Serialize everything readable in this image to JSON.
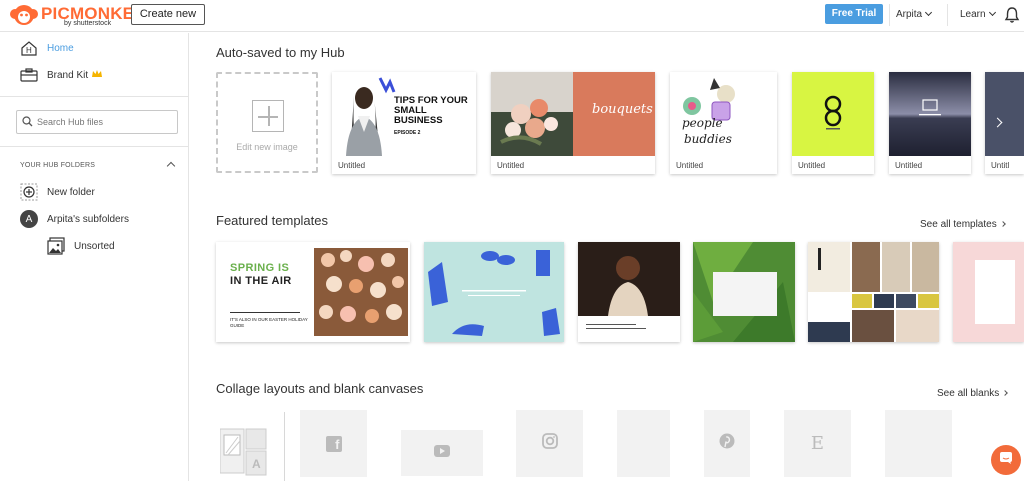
{
  "brand": {
    "name": "PICMONKEY",
    "byline": "by shutterstock",
    "accent": "#ff6b35"
  },
  "header": {
    "create_label": "Create new",
    "trial_label": "Free Trial",
    "user_label": "Arpita",
    "learn_label": "Learn"
  },
  "sidebar": {
    "home_label": "Home",
    "brandkit_label": "Brand Kit",
    "search_placeholder": "Search Hub files",
    "folders_heading": "YOUR HUB FOLDERS",
    "new_folder_label": "New folder",
    "subfolders_label": "Arpita's subfolders",
    "avatar_letter": "A",
    "unsorted_label": "Unsorted"
  },
  "autosaved": {
    "title": "Auto-saved to my Hub",
    "edit_new_label": "Edit new image",
    "cards": [
      {
        "caption": "Untitled",
        "headline": "TIPS FOR YOUR SMALL BUSINESS",
        "sub": "EPISODE 2"
      },
      {
        "caption": "Untitled",
        "script": "bouquets"
      },
      {
        "caption": "Untitled",
        "word1": "people",
        "word2": "buddies"
      },
      {
        "caption": "Untitled"
      },
      {
        "caption": "Untitled"
      },
      {
        "caption": "Untitl"
      }
    ]
  },
  "featured": {
    "title": "Featured templates",
    "see_all": "See all templates",
    "spring_line1": "SPRING IS",
    "spring_line2": "IN THE AIR",
    "spring_small": "IT'S ALSO IN OUR EASTER HOLIDAY GUIDE"
  },
  "collage": {
    "title": "Collage layouts and blank canvases",
    "see_all": "See all blanks",
    "icons": [
      "facebook-icon",
      "youtube-icon",
      "instagram-icon",
      "blank-icon",
      "pinterest-icon",
      "etsy-icon",
      "blank-icon"
    ],
    "letter_a": "A",
    "fb_glyph": "f",
    "etsy_glyph": "E"
  }
}
